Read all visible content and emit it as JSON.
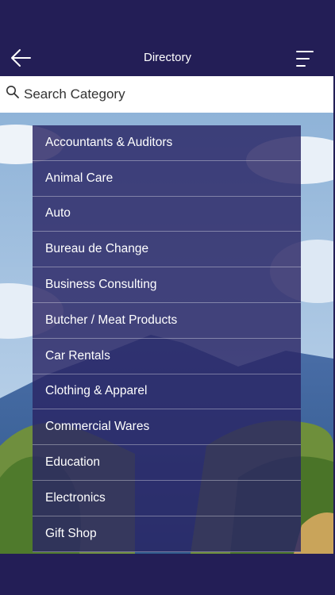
{
  "nav": {
    "title": "Directory",
    "back_icon": "arrow-left-icon",
    "menu_icon": "menu-icon"
  },
  "search": {
    "placeholder": "Search Category",
    "value": "",
    "icon": "search-icon"
  },
  "categories": [
    "Accountants & Auditors",
    "Animal Care",
    "Auto",
    "Bureau de Change",
    "Business Consulting",
    "Butcher / Meat Products",
    "Car Rentals",
    "Clothing & Apparel",
    "Commercial Wares",
    "Education",
    "Electronics",
    "Gift Shop"
  ],
  "colors": {
    "primary": "#231e56",
    "dropdown_bg": "#2a2464",
    "text_light": "#ffffff"
  }
}
